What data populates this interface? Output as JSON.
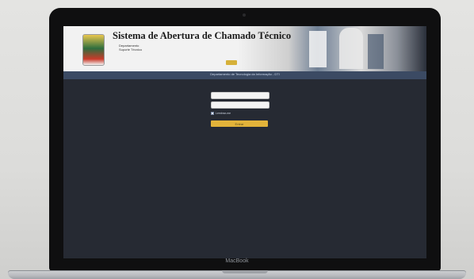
{
  "app": {
    "title": "Sistema de Abertura de Chamado Técnico",
    "department_lines": [
      "Departamento",
      "Suporte Técnico"
    ],
    "description_text": "",
    "contact_text": "",
    "subheader_text": "Departamento de Tecnologia da Informação - DTI"
  },
  "login": {
    "username_placeholder": "",
    "password_placeholder": "",
    "remember_label": "Lembrar-me",
    "submit_label": "Entrar"
  },
  "footer": {
    "text": ""
  },
  "device": {
    "brand": "MacBook"
  },
  "colors": {
    "screen_bg": "#262a33",
    "subheader_bg": "#3b4a63",
    "button": "#e2b33a"
  }
}
